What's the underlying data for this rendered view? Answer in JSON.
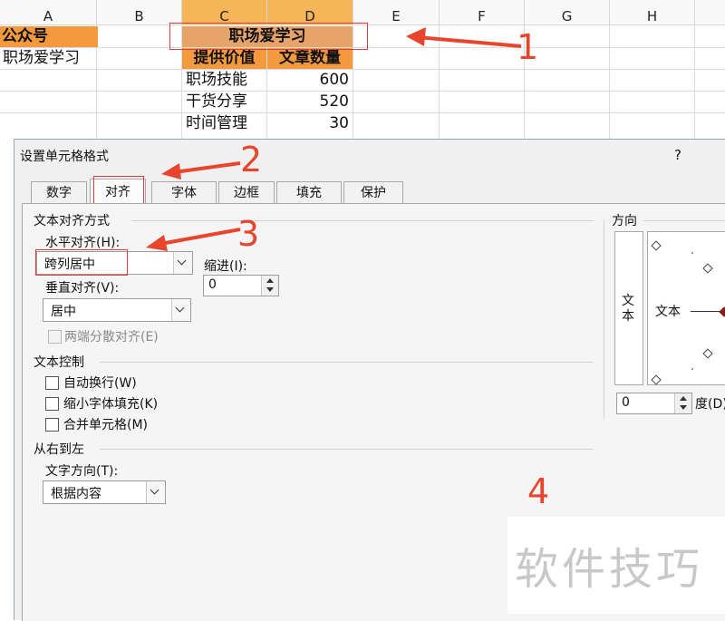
{
  "sheet": {
    "columns": [
      "A",
      "B",
      "C",
      "D",
      "E",
      "F",
      "G",
      "H"
    ],
    "rows": {
      "a1": "公众号",
      "c1_merged": "职场爱学习",
      "a2": "职场爱学习",
      "c2": "提供价值",
      "d2": "文章数量",
      "c3": "职场技能",
      "d3": "600",
      "c4": "干货分享",
      "d4": "520",
      "c5": "时间管理",
      "d5": "30"
    }
  },
  "annotations": {
    "n1": "1",
    "n2": "2",
    "n3": "3",
    "n4": "4"
  },
  "dialog": {
    "title": "设置单元格格式",
    "help": "?",
    "tabs": [
      "数字",
      "对齐",
      "字体",
      "边框",
      "填充",
      "保护"
    ],
    "text_align_section": "文本对齐方式",
    "horizontal_label": "水平对齐(H):",
    "horizontal_value": "跨列居中",
    "indent_label": "缩进(I):",
    "indent_value": "0",
    "vertical_label": "垂直对齐(V):",
    "vertical_value": "居中",
    "justify_distributed": "两端分散对齐(E)",
    "text_control_section": "文本控制",
    "wrap_text": "自动换行(W)",
    "shrink_to_fit": "缩小字体填充(K)",
    "merge_cells": "合并单元格(M)",
    "rtl_section": "从右到左",
    "text_direction_label": "文字方向(T):",
    "text_direction_value": "根据内容",
    "orientation_section": "方向",
    "orientation_vertical_text": "文本",
    "orientation_horizontal_text": "文本",
    "degree_value": "0",
    "degree_label": "度(D)"
  },
  "watermark": "软件技巧",
  "colors": {
    "orange": "#f39a3f",
    "tan": "#e6a36a",
    "selected_col": "#f5b65a",
    "annotation_red": "#e8452c"
  }
}
